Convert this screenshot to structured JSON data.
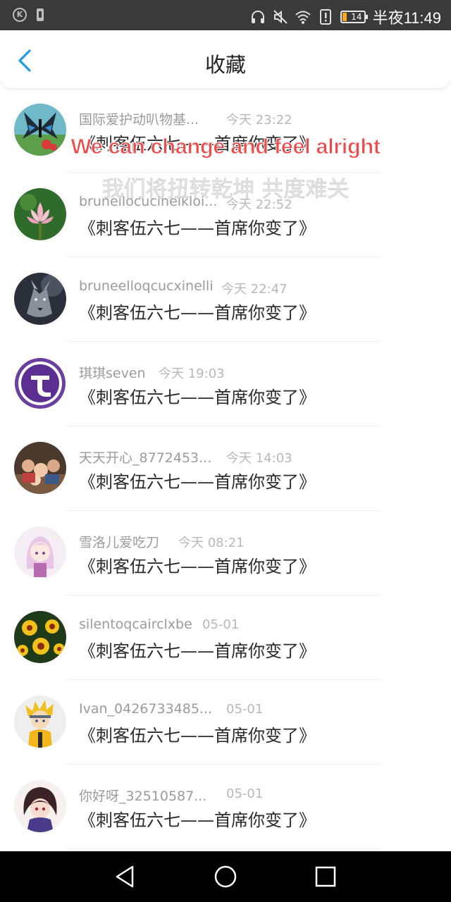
{
  "status_bar": {
    "k_icon": "K",
    "battery_level": "14",
    "time": "半夜11:49",
    "icons": [
      "headphones-icon",
      "mute-icon",
      "wifi-icon",
      "alert-icon",
      "battery-icon"
    ]
  },
  "header": {
    "title": "收藏",
    "back_icon": "chevron-left-icon",
    "accent_color": "#1e9be8"
  },
  "overlay": {
    "english": "We can change and feel alright",
    "chinese": "我们将扭转乾坤 共度难关"
  },
  "items": [
    {
      "name": "国际爱护动叭物基...",
      "time": "今天 23:22",
      "title": "《刺客伍六七——首席你变了》",
      "avatar": "butterfly"
    },
    {
      "name": "brunellocucinelkloi...",
      "time": "今天 22:52",
      "title": "《刺客伍六七——首席你变了》",
      "avatar": "lotus"
    },
    {
      "name": "bruneelloqcucxinelli",
      "time": "今天 22:47",
      "title": "《刺客伍六七——首席你变了》",
      "avatar": "wolf"
    },
    {
      "name": "琪琪seven",
      "time": "今天 19:03",
      "title": "《刺客伍六七——首席你变了》",
      "avatar": "logo"
    },
    {
      "name": "天天开心_8772453...",
      "time": "今天 14:03",
      "title": "《刺客伍六七——首席你变了》",
      "avatar": "family"
    },
    {
      "name": "雪洛儿爱吃刀",
      "time": "今天 08:21",
      "title": "《刺客伍六七——首席你变了》",
      "avatar": "anime-girl"
    },
    {
      "name": "silentoqcairclxbe",
      "time": "05-01",
      "title": "《刺客伍六七——首席你变了》",
      "avatar": "flowers"
    },
    {
      "name": "Ivan_0426733485...",
      "time": "05-01",
      "title": "《刺客伍六七——首席你变了》",
      "avatar": "naruto"
    },
    {
      "name": "你好呀_32510587...",
      "time": "05-01",
      "title": "《刺客伍六七——首席你变了》",
      "avatar": "anime-boy"
    }
  ],
  "nav_bar": {
    "buttons": [
      "back-triangle-icon",
      "home-circle-icon",
      "recents-square-icon"
    ]
  }
}
